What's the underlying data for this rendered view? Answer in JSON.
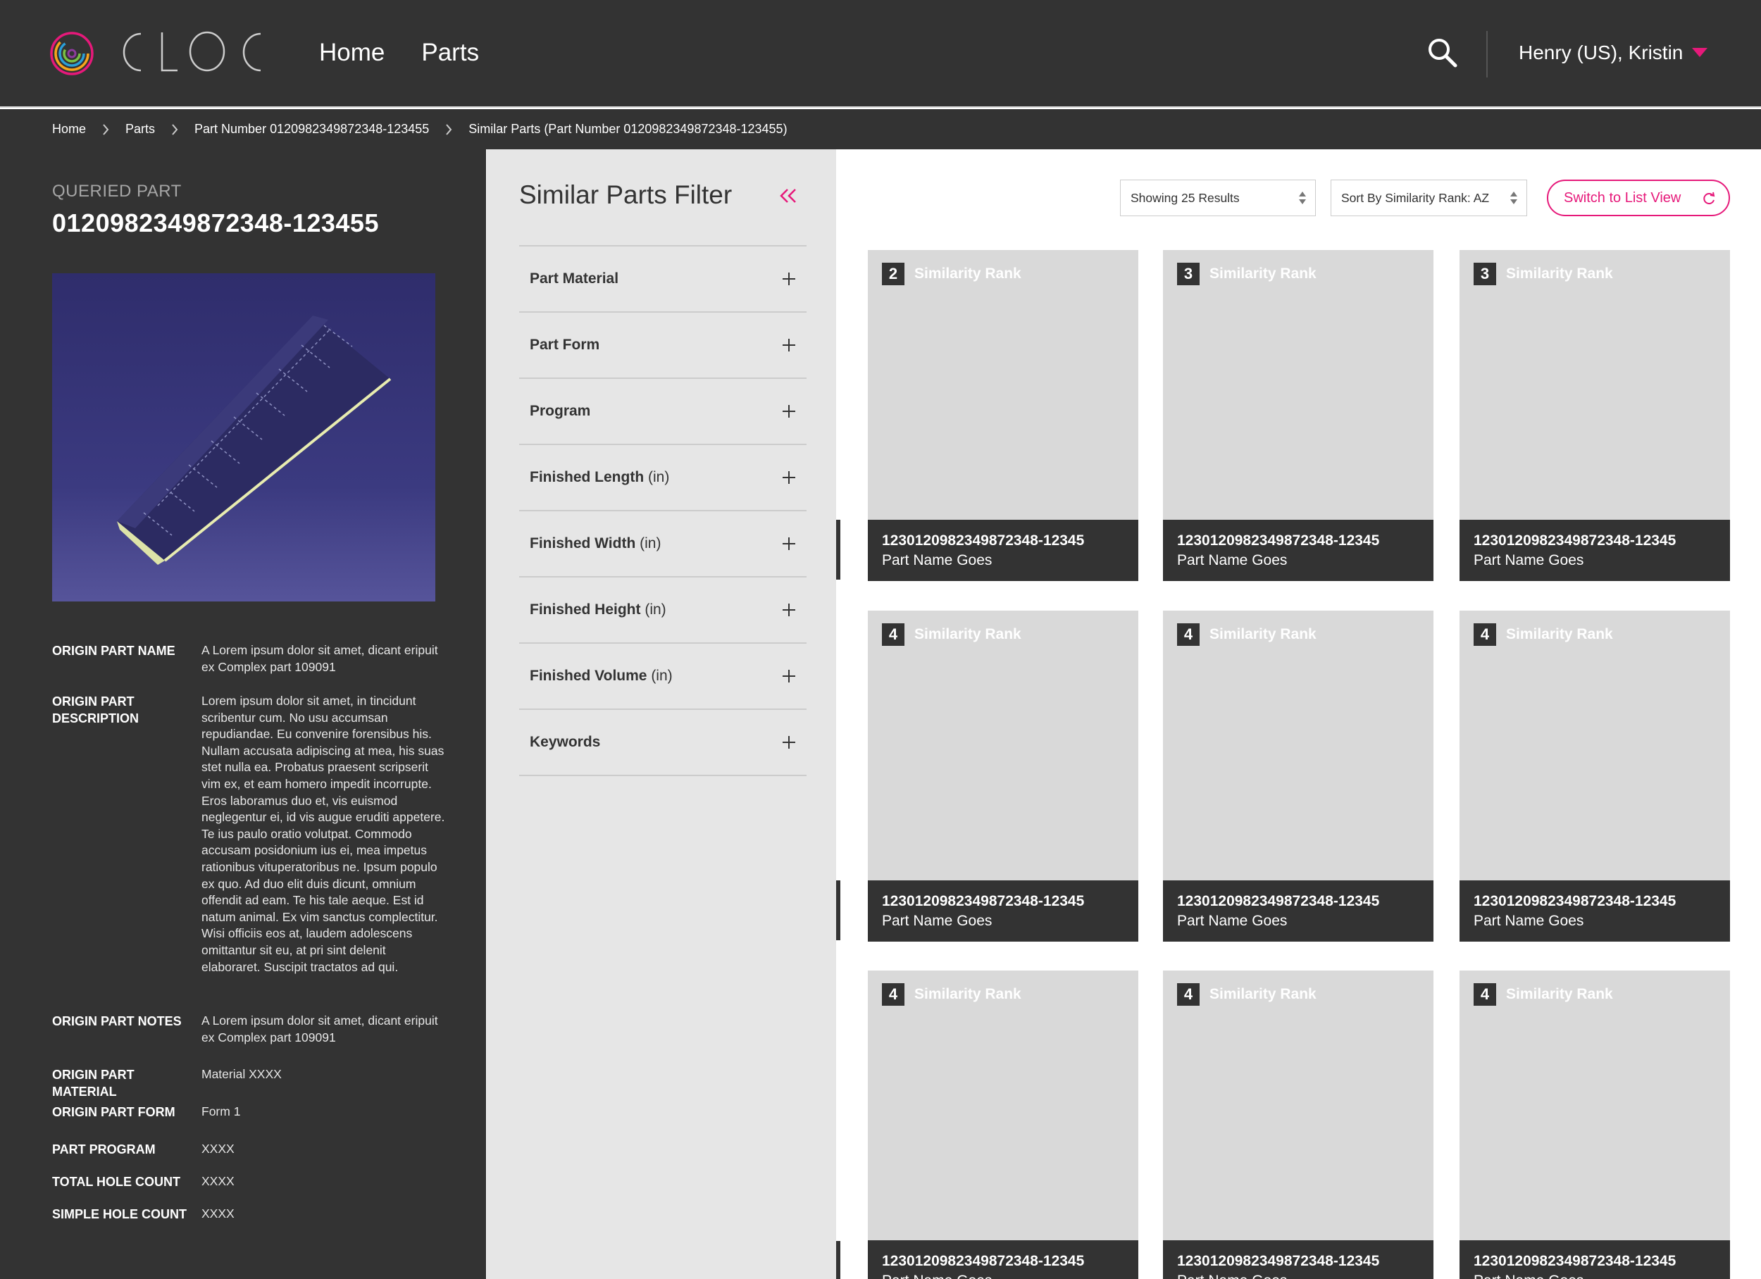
{
  "header": {
    "logo_icon": "cloc-logo-rings-icon",
    "nav": [
      "Home",
      "Parts"
    ],
    "search_icon": "search-icon",
    "user_name": "Henry (US), Kristin",
    "accent_color": "#e6197a"
  },
  "breadcrumb": [
    "Home",
    "Parts",
    "Part Number 0120982349872348-123455",
    "Similar Parts (Part Number 0120982349872348-123455)"
  ],
  "queried_part": {
    "label": "QUERIED PART",
    "number": "0120982349872348-123455",
    "metadata": [
      {
        "key": "ORIGIN PART NAME",
        "value": "A Lorem ipsum dolor sit amet, dicant eripuit ex Complex part 109091"
      },
      {
        "key": "ORIGIN PART DESCRIPTION",
        "value": "Lorem ipsum dolor sit amet, in tincidunt scribentur cum. No usu accumsan repudiandae. Eu convenire forensibus his. Nullam accusata adipiscing at mea, his suas stet nulla ea. Probatus praesent scripserit vim ex, et eam homero impedit incorrupte. Eros laboramus duo et, vis euismod neglegentur ei, id vis augue eruditi appetere. Te ius paulo oratio volutpat. Commodo accusam posidonium ius ei, mea impetus rationibus vituperatoribus ne. Ipsum populo ex quo. Ad duo elit duis dicunt, omnium offendit ad eam. Te his tale aeque. Est id natum animal. Ex vim sanctus complectitur. Wisi officiis eos at, laudem adolescens omittantur sit eu, at pri sint delenit elaboraret. Suscipit tractatos ad qui."
      },
      {
        "key": "ORIGIN PART NOTES",
        "value": "A Lorem ipsum dolor sit amet, dicant eripuit ex Complex part 109091"
      },
      {
        "key": "ORIGIN PART MATERIAL",
        "value": "Material XXXX"
      },
      {
        "key": "ORIGIN PART FORM",
        "value": "Form 1"
      },
      {
        "key": "PART PROGRAM",
        "value": "XXXX"
      },
      {
        "key": "TOTAL HOLE COUNT",
        "value": "XXXX"
      },
      {
        "key": "SIMPLE HOLE COUNT",
        "value": "XXXX"
      }
    ]
  },
  "filter": {
    "title": "Similar Parts Filter",
    "collapse_icon": "double-chevron-left-icon",
    "items": [
      {
        "label": "Part Material",
        "unit": ""
      },
      {
        "label": "Part Form",
        "unit": ""
      },
      {
        "label": "Program",
        "unit": ""
      },
      {
        "label": "Finished Length",
        "unit": "(in)"
      },
      {
        "label": "Finished Width",
        "unit": "(in)"
      },
      {
        "label": "Finished Height",
        "unit": "(in)"
      },
      {
        "label": "Finished Volume",
        "unit": "(in)"
      },
      {
        "label": "Keywords",
        "unit": ""
      }
    ]
  },
  "toolbar": {
    "results_select": "Showing 25 Results",
    "sort_select": "Sort By Similarity Rank: AZ",
    "switch_button": "Switch to List View"
  },
  "cards": [
    {
      "rank": "2",
      "rank_label": "Similarity Rank",
      "part_number": "1230120982349872348-12345",
      "part_name": "Part Name Goes"
    },
    {
      "rank": "3",
      "rank_label": "Similarity Rank",
      "part_number": "1230120982349872348-12345",
      "part_name": "Part Name Goes"
    },
    {
      "rank": "3",
      "rank_label": "Similarity Rank",
      "part_number": "1230120982349872348-12345",
      "part_name": "Part Name Goes"
    },
    {
      "rank": "4",
      "rank_label": "Similarity Rank",
      "part_number": "1230120982349872348-12345",
      "part_name": "Part Name Goes"
    },
    {
      "rank": "4",
      "rank_label": "Similarity Rank",
      "part_number": "1230120982349872348-12345",
      "part_name": "Part Name Goes"
    },
    {
      "rank": "4",
      "rank_label": "Similarity Rank",
      "part_number": "1230120982349872348-12345",
      "part_name": "Part Name Goes"
    },
    {
      "rank": "4",
      "rank_label": "Similarity Rank",
      "part_number": "1230120982349872348-12345",
      "part_name": "Part Name Goes"
    },
    {
      "rank": "4",
      "rank_label": "Similarity Rank",
      "part_number": "1230120982349872348-12345",
      "part_name": "Part Name Goes"
    },
    {
      "rank": "4",
      "rank_label": "Similarity Rank",
      "part_number": "1230120982349872348-12345",
      "part_name": "Part Name Goes"
    }
  ]
}
